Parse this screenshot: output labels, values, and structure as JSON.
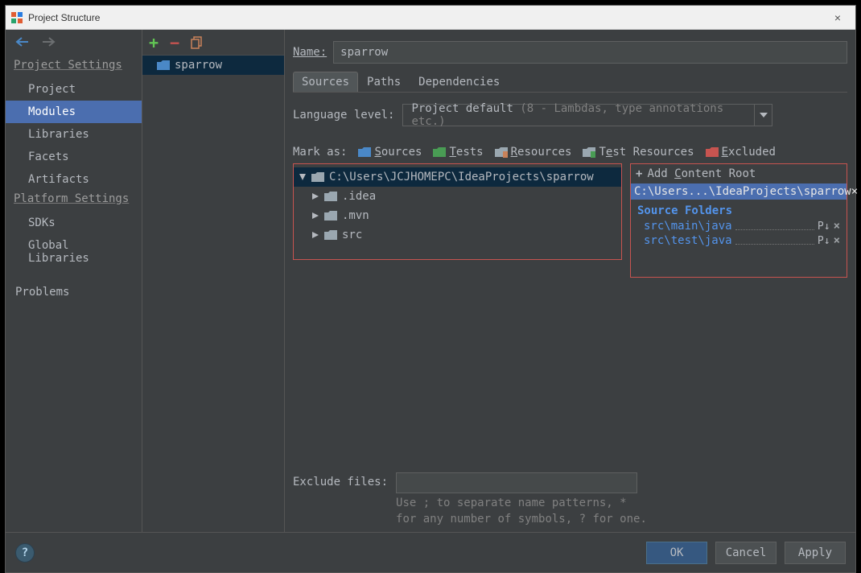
{
  "titlebar": {
    "title": "Project Structure",
    "close": "×"
  },
  "leftnav": {
    "section1": "Project Settings",
    "items1": [
      "Project",
      "Modules",
      "Libraries",
      "Facets",
      "Artifacts"
    ],
    "section2": "Platform Settings",
    "items2": [
      "SDKs",
      "Global Libraries"
    ],
    "section3": "Problems"
  },
  "mid": {
    "module": "sparrow"
  },
  "right": {
    "name_label": "Name:",
    "name_value": "sparrow",
    "tabs": [
      "Sources",
      "Paths",
      "Dependencies"
    ],
    "lang_label": "Language level:",
    "lang_value_main": "Project default ",
    "lang_value_dim": "(8 - Lambdas, type annotations etc.)",
    "mark_label": "Mark as:",
    "marks": {
      "sources": "Sources",
      "tests": "Tests",
      "resources": "Resources",
      "test_resources": "Test Resources",
      "excluded": "Excluded"
    },
    "tree": {
      "root": "C:\\Users\\JCJHOMEPC\\IdeaProjects\\sparrow",
      "items": [
        ".idea",
        ".mvn",
        "src"
      ]
    },
    "roots": {
      "add_label": "Add Content Root",
      "path": "C:\\Users...\\IdeaProjects\\sparrow",
      "source_folders_label": "Source Folders",
      "folders": [
        "src\\main\\java",
        "src\\test\\java"
      ]
    },
    "exclude_label": "Exclude files:",
    "exclude_hint1": "Use ; to separate name patterns, *",
    "exclude_hint2": "for any number of symbols, ? for one."
  },
  "footer": {
    "ok": "OK",
    "cancel": "Cancel",
    "apply": "Apply"
  },
  "colors": {
    "sources": "#4a88c7",
    "tests": "#499c54",
    "resources": "#9aa7b0",
    "test_resources": "#9aa7b0",
    "test_resources_stripe": "#499c54",
    "excluded": "#c75450"
  }
}
